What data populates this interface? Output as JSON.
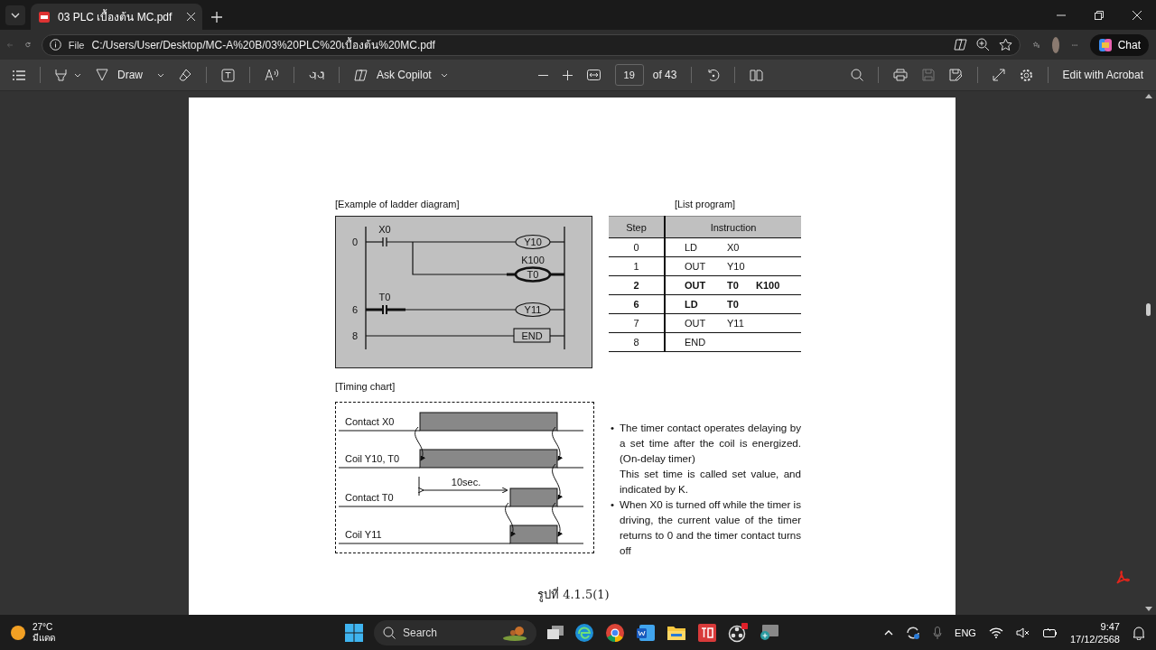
{
  "browser": {
    "tabs": [
      {
        "title": "03 PLC เบื้องต้น MC.pdf",
        "selected": true
      }
    ],
    "address": {
      "scheme": "File",
      "url": "C:/Users/User/Desktop/MC-A%20B/03%20PLC%20เบื้องต้น%20MC.pdf"
    },
    "chat_label": "Chat"
  },
  "pdf_toolbar": {
    "draw_label": "Draw",
    "copilot_label": "Ask Copilot",
    "page": "19",
    "page_total": "of 43",
    "acrobat_label": "Edit with Acrobat"
  },
  "page": {
    "ladder": {
      "title": "[Example of ladder diagram]",
      "rungs": [
        {
          "kind": "coil",
          "step": "0",
          "contact": "X0",
          "output": "Y10",
          "highlighted": false
        },
        {
          "kind": "timer",
          "output": "T0",
          "setting": "K100",
          "highlighted": true
        },
        {
          "kind": "coil",
          "step": "6",
          "contact": "T0",
          "output": "Y11",
          "highlighted": true
        },
        {
          "kind": "end",
          "step": "8",
          "output": "END",
          "highlighted": false
        }
      ]
    },
    "list_program": {
      "title": "[List program]",
      "columns": [
        "Step",
        "Instruction"
      ],
      "rows": [
        {
          "step": "0",
          "op": "LD",
          "operand": "X0",
          "bold": false
        },
        {
          "step": "1",
          "op": "OUT",
          "operand": "Y10",
          "bold": false
        },
        {
          "step": "2",
          "op": "OUT",
          "operand": "T0",
          "setting": "K100",
          "bold": true
        },
        {
          "step": "6",
          "op": "LD",
          "operand": "T0",
          "bold": true
        },
        {
          "step": "7",
          "op": "OUT",
          "operand": "Y11",
          "bold": false
        },
        {
          "step": "8",
          "op": "END",
          "bold": false
        }
      ]
    },
    "timing": {
      "title": "[Timing chart]",
      "delay_label": "10sec.",
      "signals": [
        {
          "label": "Contact X0",
          "kind": "input"
        },
        {
          "label": "Coil Y10, T0",
          "kind": "input"
        },
        {
          "label": "Contact T0",
          "kind": "delayed"
        },
        {
          "label": "Coil Y11",
          "kind": "delayed"
        }
      ]
    },
    "notes": [
      {
        "kind": "bullet",
        "marker": "•",
        "text": "The timer contact operates delaying by a set time after the coil is energized. (On-delay timer)"
      },
      {
        "kind": "continuation",
        "text": "This set time is called set value, and indicated by K."
      },
      {
        "kind": "bullet",
        "marker": "•",
        "text": "When X0 is turned off while the timer is driving, the current value of the timer returns to 0 and the timer contact turns off"
      }
    ],
    "caption": "รูปที่ 4.1.5(1)"
  },
  "taskbar": {
    "temperature": "27°C",
    "weather": "มีแดด",
    "search_label": "Search",
    "language": "ENG",
    "time": "9:47",
    "date": "17/12/2568"
  }
}
